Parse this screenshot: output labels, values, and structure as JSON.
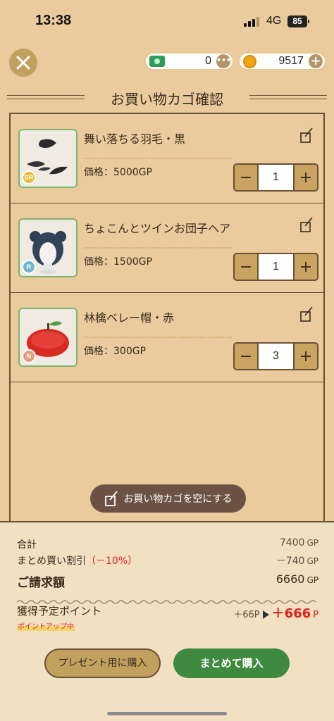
{
  "status": {
    "time": "13:38",
    "network": "4G",
    "battery": "85"
  },
  "header": {
    "title": "お買い物カゴ確認",
    "ticket_count": "0",
    "coin_count": "9517"
  },
  "items": [
    {
      "name": "舞い落ちる羽毛・黒",
      "price": "価格：5000GP",
      "qty": "1",
      "rarity": "SR",
      "rarity_color": "#E8B932"
    },
    {
      "name": "ちょこんとツインお団子ヘア",
      "price": "価格：1500GP",
      "qty": "1",
      "rarity": "R",
      "rarity_color": "#6FB5C9"
    },
    {
      "name": "林檎ベレー帽・赤",
      "price": "価格：300GP",
      "qty": "3",
      "rarity": "N",
      "rarity_color": "#E39C78"
    }
  ],
  "empty_cart_label": "お買い物カゴを空にする",
  "summary": {
    "subtotal_label": "合計",
    "subtotal_value": "7400",
    "discount_label": "まとめ買い割引",
    "discount_rate": "（－10%）",
    "discount_value": "－740",
    "total_label": "ご請求額",
    "total_value": "6660",
    "unit": "GP",
    "points_label": "獲得予定ポイント",
    "points_old": "＋66P",
    "points_new": "＋666",
    "points_unit": "P",
    "points_badge": "ポイントアップ中"
  },
  "buttons": {
    "gift": "プレゼント用に購入",
    "buy": "まとめて購入"
  },
  "colors": {
    "accent_green": "#3E8A3E",
    "brown": "#6B5034",
    "background": "#EBCB9D",
    "red": "#E0201A"
  }
}
